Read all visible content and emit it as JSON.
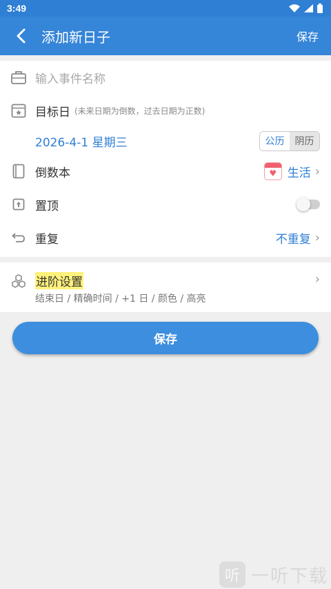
{
  "status": {
    "time": "3:49",
    "icons": [
      "wifi-icon",
      "signal-icon",
      "battery-icon"
    ]
  },
  "appbar": {
    "title": "添加新日子",
    "save_label": "保存"
  },
  "form": {
    "name_placeholder": "输入事件名称",
    "target_label": "目标日",
    "target_hint": "(未来日期为倒数，过去日期为正数)",
    "date_value": "2026-4-1 星期三",
    "calendar_options": [
      "公历",
      "阴历"
    ],
    "calendar_selected": "公历",
    "book_label": "倒数本",
    "book_value": "生活",
    "pin_label": "置顶",
    "pin_on": false,
    "repeat_label": "重复",
    "repeat_value": "不重复"
  },
  "advanced": {
    "title": "进阶设置",
    "subtitle": "结束日 / 精确时间 / +1 日 / 颜色 / 高亮"
  },
  "save_button": "保存",
  "watermark": {
    "logo": "听",
    "text": "一听下载"
  },
  "colors": {
    "primary": "#3585d8",
    "accent_blue": "#2f7fd4",
    "highlight": "#fff27a",
    "life_red": "#f0606e"
  }
}
